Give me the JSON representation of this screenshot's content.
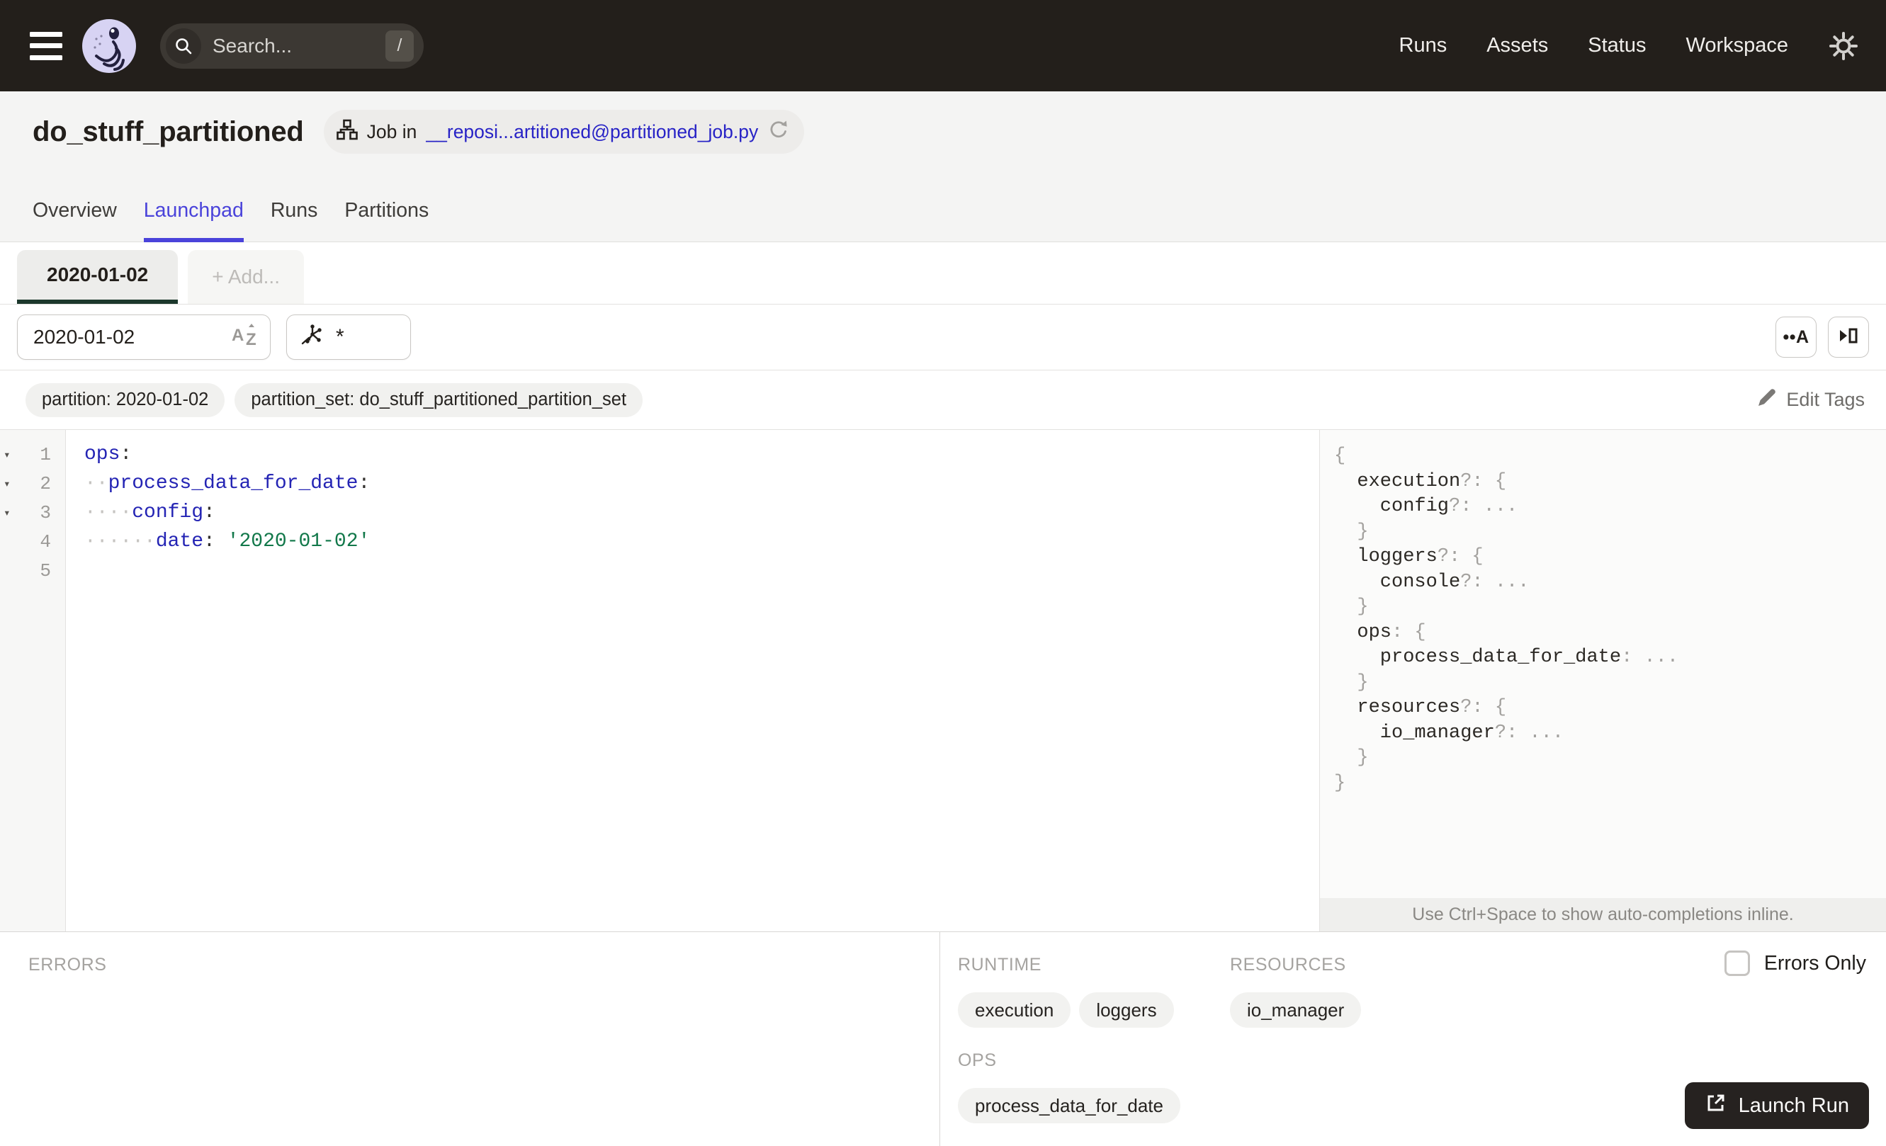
{
  "nav": {
    "search_placeholder": "Search...",
    "search_shortcut": "/",
    "links": [
      {
        "label": "Runs"
      },
      {
        "label": "Assets"
      },
      {
        "label": "Status"
      },
      {
        "label": "Workspace"
      }
    ]
  },
  "header": {
    "title": "do_stuff_partitioned",
    "job_badge": {
      "prefix": "Job in",
      "link": "__reposi...artitioned@partitioned_job.py"
    },
    "tabs": [
      {
        "label": "Overview"
      },
      {
        "label": "Launchpad"
      },
      {
        "label": "Runs"
      },
      {
        "label": "Partitions"
      }
    ]
  },
  "session": {
    "active_tab": "2020-01-02",
    "add_tab": "+ Add..."
  },
  "config_bar": {
    "partition_input": "2020-01-02",
    "op_selector": "*"
  },
  "tags": {
    "items": [
      {
        "label": "partition: 2020-01-02"
      },
      {
        "label": "partition_set: do_stuff_partitioned_partition_set"
      }
    ],
    "edit_label": "Edit Tags"
  },
  "editor": {
    "fold_icon": "▾",
    "whitespace_icon": "••A",
    "lines": [
      {
        "num": "1",
        "ws": "",
        "key": "ops",
        "punc": ":",
        "value": ""
      },
      {
        "num": "2",
        "ws": "··",
        "key": "process_data_for_date",
        "punc": ":",
        "value": ""
      },
      {
        "num": "3",
        "ws": "····",
        "key": "config",
        "punc": ":",
        "value": ""
      },
      {
        "num": "4",
        "ws": "······",
        "key": "date",
        "punc": ":",
        "value": " '2020-01-02'"
      },
      {
        "num": "5",
        "ws": "",
        "key": "",
        "punc": "",
        "value": ""
      }
    ]
  },
  "schema_panel": {
    "lines": [
      {
        "name": "",
        "punc": "{"
      },
      {
        "name": "execution",
        "punc": "?: {"
      },
      {
        "name": "config",
        "punc": "?: ..."
      },
      {
        "name": "",
        "punc": "}"
      },
      {
        "name": "loggers",
        "punc": "?: {"
      },
      {
        "name": "console",
        "punc": "?: ..."
      },
      {
        "name": "",
        "punc": "}"
      },
      {
        "name": "ops",
        "punc": ": {"
      },
      {
        "name": "process_data_for_date",
        "punc": ": ..."
      },
      {
        "name": "",
        "punc": "}"
      },
      {
        "name": "resources",
        "punc": "?: {"
      },
      {
        "name": "io_manager",
        "punc": "?: ..."
      },
      {
        "name": "",
        "punc": "}"
      },
      {
        "name": "",
        "punc": "}"
      }
    ],
    "hint": "Use Ctrl+Space to show auto-completions inline."
  },
  "bottom": {
    "errors_heading": "ERRORS",
    "runtime_heading": "RUNTIME",
    "runtime_tags": [
      {
        "label": "execution"
      },
      {
        "label": "loggers"
      }
    ],
    "resources_heading": "RESOURCES",
    "resources_tags": [
      {
        "label": "io_manager"
      }
    ],
    "ops_heading": "OPS",
    "ops_tags": [
      {
        "label": "process_data_for_date"
      }
    ],
    "errors_only_label": "Errors Only",
    "launch_label": "Launch Run"
  },
  "colors": {
    "nav_bg": "#231F1B",
    "accent_indigo": "#4A43DA",
    "link_blue": "#2823C6",
    "code_key": "#2424B4",
    "code_string": "#12784A",
    "session_underline": "#1C382C"
  }
}
